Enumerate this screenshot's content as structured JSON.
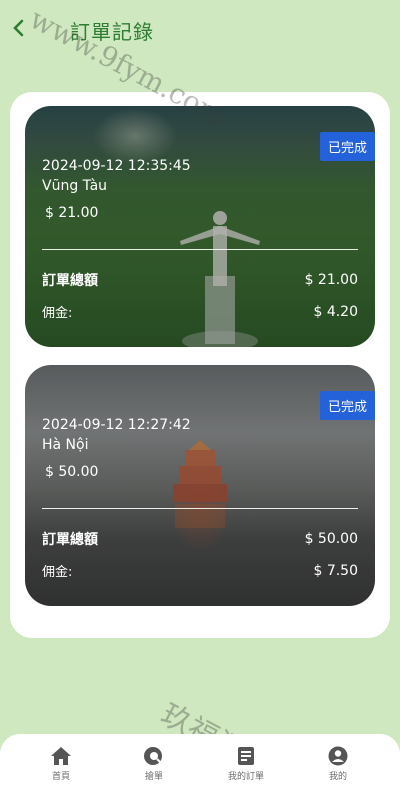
{
  "header": {
    "back_icon": "chevron-left-icon",
    "title": "訂單記錄"
  },
  "orders": [
    {
      "status": "已完成",
      "datetime": "2024-09-12 12:35:45",
      "location": "Vũng Tàu",
      "price": "$ 21.00",
      "total_label": "訂單總額",
      "total_value": "$ 21.00",
      "commission_label": "佣金:",
      "commission_value": "$ 4.20"
    },
    {
      "status": "已完成",
      "datetime": "2024-09-12 12:27:42",
      "location": "Hà Nội",
      "price": "$ 50.00",
      "total_label": "訂單總額",
      "total_value": "$ 50.00",
      "commission_label": "佣金:",
      "commission_value": "$ 7.50"
    }
  ],
  "watermarks": [
    "www.9fym.com",
    "玖福源码"
  ],
  "bottom_nav": [
    {
      "label": "首頁",
      "icon": "home-icon"
    },
    {
      "label": "搶單",
      "icon": "search-grab-icon"
    },
    {
      "label": "我的訂單",
      "icon": "orders-icon"
    },
    {
      "label": "我的",
      "icon": "user-icon"
    }
  ],
  "colors": {
    "background": "#cfe8bf",
    "accent_green": "#2e7d32",
    "badge_blue": "#2462d9"
  }
}
